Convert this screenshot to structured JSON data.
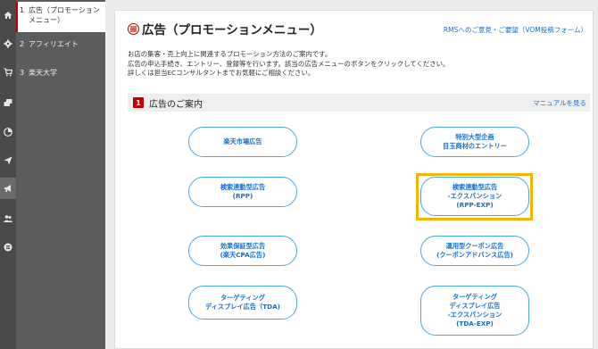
{
  "rail": {
    "icons": [
      "home-icon",
      "gear-icon",
      "cart-icon",
      "cards-icon",
      "pie-chart-icon",
      "send-icon",
      "megaphone-icon",
      "users-icon",
      "list-icon"
    ]
  },
  "subnav": {
    "items": [
      {
        "num": "1",
        "label": "広告（プロモーションメニュー）"
      },
      {
        "num": "2",
        "label": "アフィリエイト"
      },
      {
        "num": "3",
        "label": "楽天大学"
      }
    ]
  },
  "page": {
    "title": "広告（プロモーションメニュー）",
    "feedback_link": "RMSへのご意見・ご要望（VOM投稿フォーム）",
    "intro_lines": [
      "お店の集客・売上向上に関連するプロモーション方法のご案内です。",
      "広告の申込手続き、エントリー、登録等を行います。該当の広告メニューのボタンをクリックしてください。",
      "詳しくは担当ECコンサルタントまでお気軽にご相談ください。"
    ]
  },
  "section": {
    "number": "1",
    "title": "広告のご案内",
    "manual_link": "マニュアルを見る"
  },
  "ad_buttons": [
    {
      "lines": [
        "楽天市場広告"
      ]
    },
    {
      "lines": [
        "特別大型企画",
        "目玉商材のエントリー"
      ]
    },
    {
      "lines": [
        "検索連動型広告",
        "(RPP)"
      ]
    },
    {
      "lines": [
        "検索連動型広告",
        "-エクスパンション",
        "(RPP-EXP)"
      ]
    },
    {
      "lines": [
        "効果保証型広告",
        "(楽天CPA広告)"
      ]
    },
    {
      "lines": [
        "運用型クーポン広告",
        "(クーポンアドバンス広告)"
      ]
    },
    {
      "lines": [
        "ターゲティング",
        "ディスプレイ広告（TDA)"
      ]
    },
    {
      "lines": [
        "ターゲティング",
        "ディスプレイ広告",
        "-エクスパンション",
        "(TDA-EXP)"
      ]
    }
  ],
  "colors": {
    "brand_red": "#bf0000",
    "link_blue": "#1a6fc9",
    "button_border": "#45a8e6",
    "highlight": "#f2b705"
  }
}
